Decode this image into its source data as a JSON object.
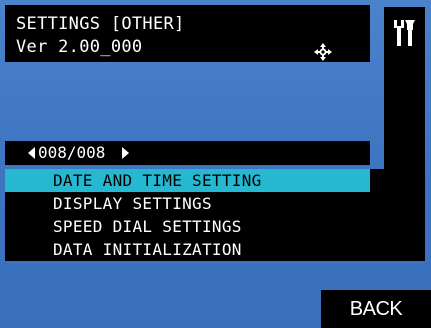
{
  "header": {
    "title": "SETTINGS [OTHER]",
    "version": "Ver 2.00_000",
    "move_icon": "move-arrows-icon"
  },
  "toolbar": {
    "icon": "wrench-screwdriver-icon"
  },
  "pagination": {
    "label": "008/008"
  },
  "menu": {
    "items": [
      {
        "label": "DATE AND TIME SETTING",
        "selected": true
      },
      {
        "label": "DISPLAY SETTINGS",
        "selected": false
      },
      {
        "label": "SPEED DIAL SETTINGS",
        "selected": false
      },
      {
        "label": "DATA INITIALIZATION",
        "selected": false
      }
    ]
  },
  "footer": {
    "back_label": "BACK"
  },
  "colors": {
    "background": "#3f78c4",
    "panel": "#000000",
    "selected": "#26b8d0",
    "text": "#ffffff"
  }
}
